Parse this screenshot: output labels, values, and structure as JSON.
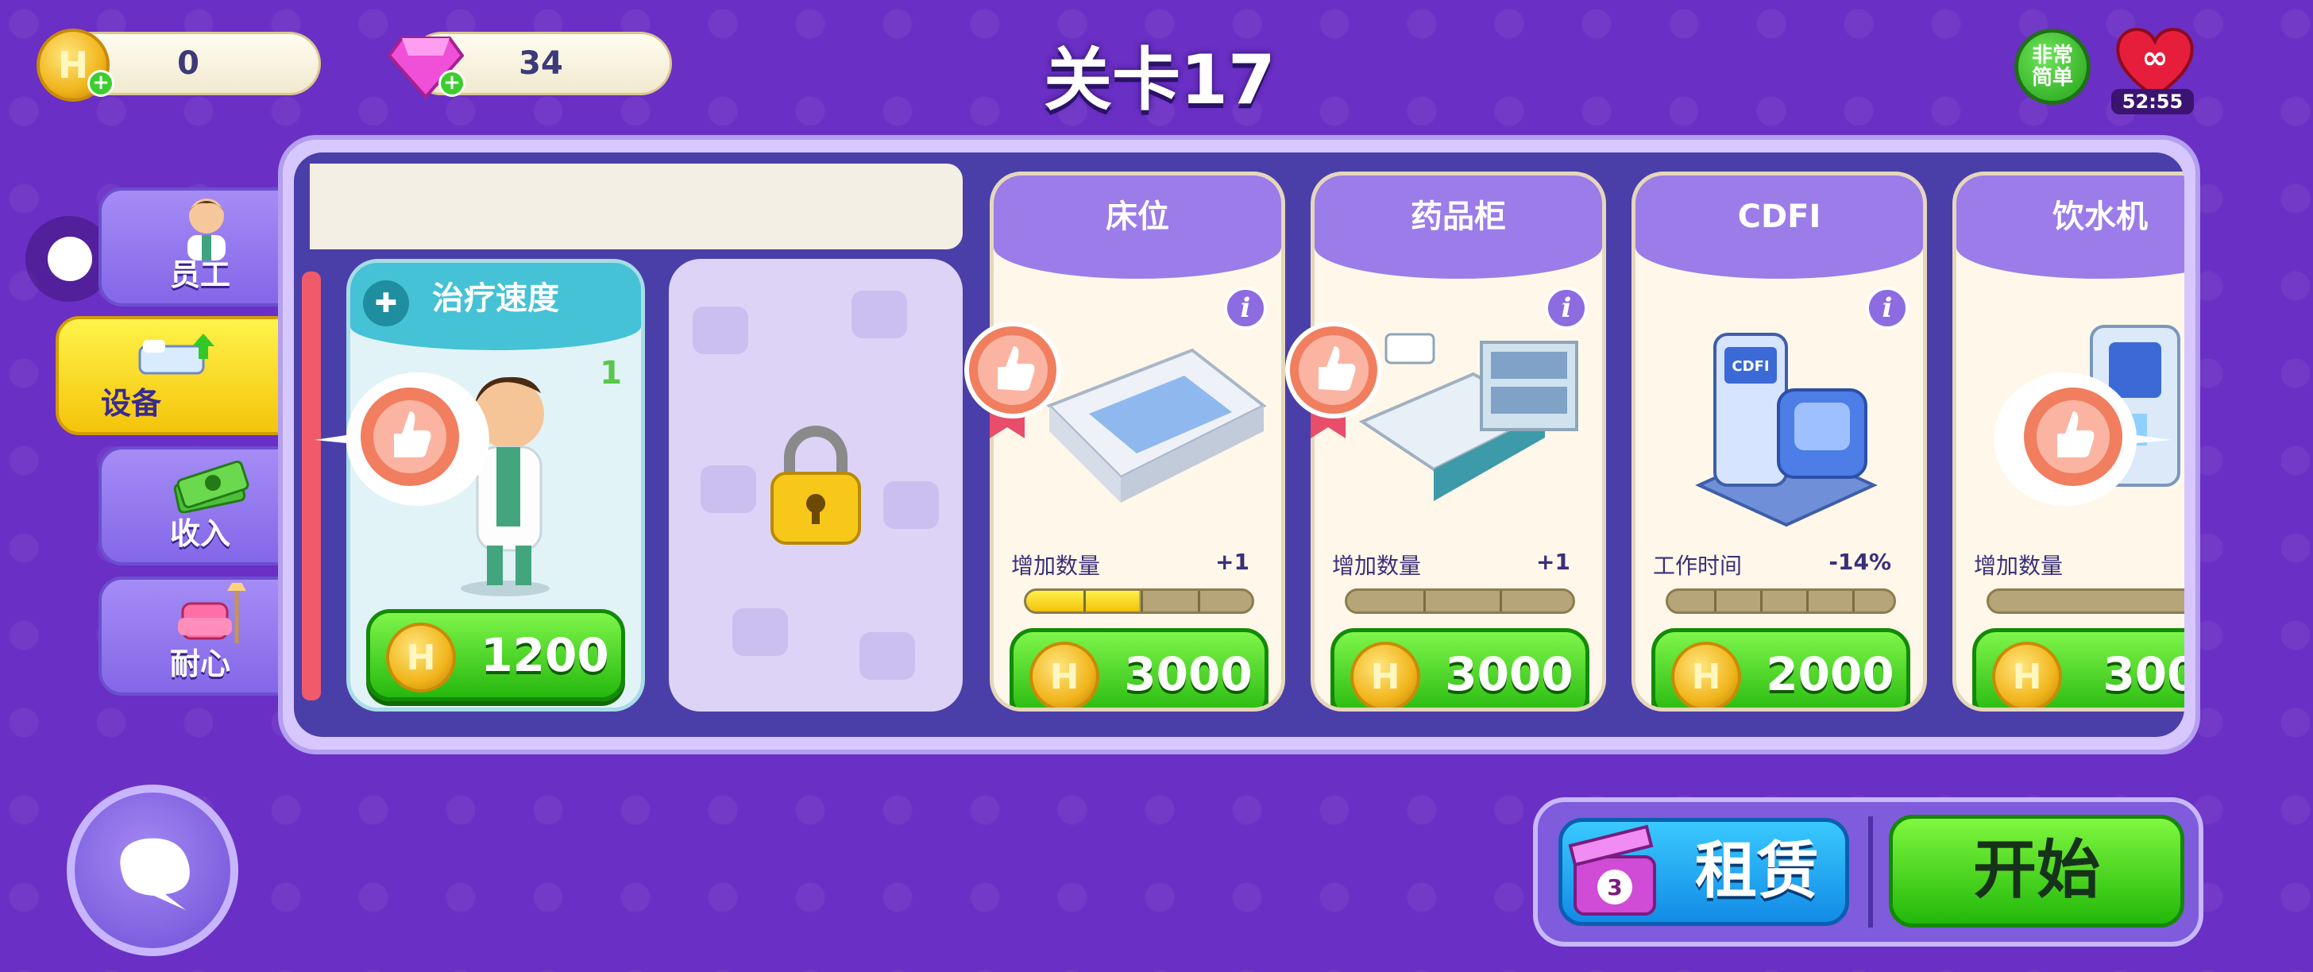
{
  "top_bar": {
    "coins": "0",
    "coin_symbol": "H",
    "gems": "34",
    "level_title": "关卡17",
    "difficulty": [
      "非常",
      "简单"
    ],
    "lives_icon": "infinity-heart-icon",
    "timer": "52:55"
  },
  "side_tabs": [
    {
      "label": "员工",
      "icon": "doctor-avatar-icon",
      "active": false
    },
    {
      "label": "设备",
      "icon": "bed-upgrade-icon",
      "active": true
    },
    {
      "label": "收入",
      "icon": "cash-stack-icon",
      "active": false
    },
    {
      "label": "耐心",
      "icon": "armchair-icon",
      "active": false
    }
  ],
  "staff_card": {
    "title": "治疗速度",
    "level": "1",
    "price": "1200"
  },
  "equipment": [
    {
      "name": "床位",
      "stat_label": "增加数量",
      "stat_value": "+1",
      "price": "3000",
      "progress": 0.5
    },
    {
      "name": "药品柜",
      "stat_label": "增加数量",
      "stat_value": "+1",
      "price": "3000",
      "progress": 0
    },
    {
      "name": "CDFI",
      "stat_label": "工作时间",
      "stat_value": "-14%",
      "price": "2000",
      "progress": 0
    },
    {
      "name": "饮水机",
      "stat_label": "增加数量",
      "stat_value": "",
      "price": "300",
      "progress": 0
    }
  ],
  "bottom": {
    "rent_label": "租赁",
    "rent_count": "3",
    "start_label": "开始"
  },
  "colors": {
    "background": "#6a2fc4",
    "active_tab": "#f4c40a",
    "buy_button": "#26b80e",
    "rent_button": "#128be6"
  }
}
